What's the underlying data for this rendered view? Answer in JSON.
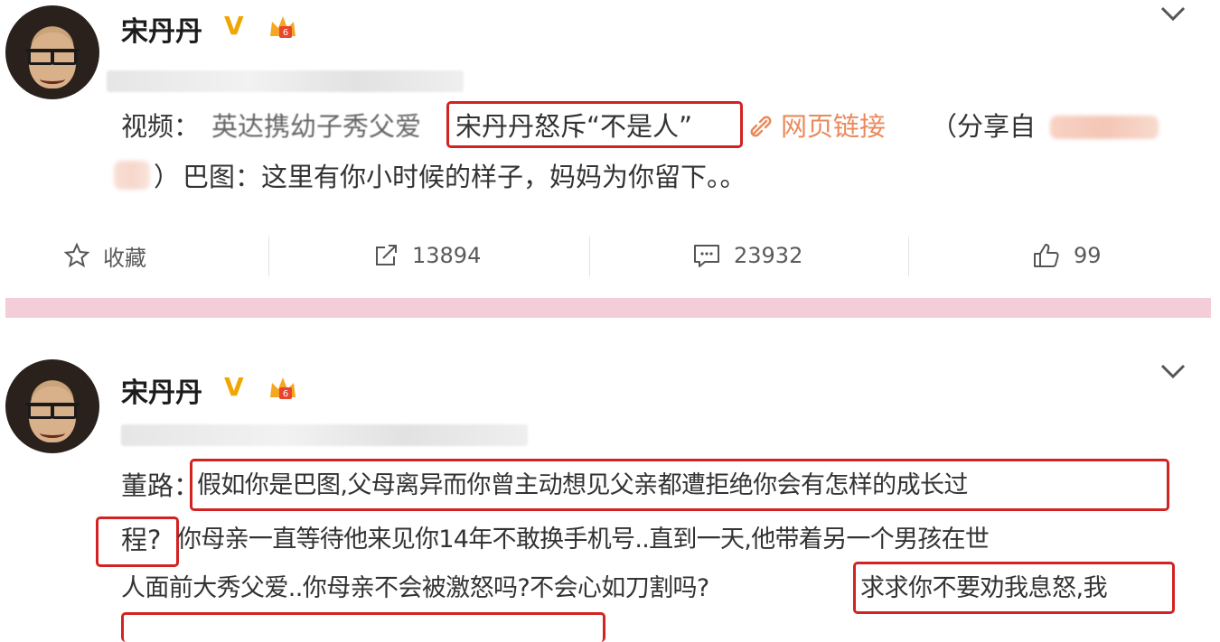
{
  "posts": [
    {
      "username": "宋丹丹",
      "verified_mark": "V",
      "body_line1": {
        "prefix": "视频：",
        "title_blurred": "英达携幼子秀父爱",
        "highlight": "宋丹丹怒斥“不是人”",
        "link_icon": "link-icon",
        "link_label": "网页链接",
        "share_prefix": "（分享自"
      },
      "body_line2": {
        "close": "）",
        "text": "巴图：这里有你小时候的样子，妈妈为你留下。。"
      },
      "actions": {
        "favorite_label": "收藏",
        "repost_count": "13894",
        "comment_count": "23932",
        "like_count": "99"
      }
    },
    {
      "username": "宋丹丹",
      "verified_mark": "V",
      "body": {
        "line1_prefix": "董路：",
        "line1_highlight": "假如你是巴图,父母离异而你曾主动想见父亲都遭拒绝你会有怎样的成长过",
        "line2_highlight": "程?",
        "line2_rest": "你母亲一直等待他来见你14年不敢换手机号..直到一天,他带着另一个男孩在世",
        "line3_text": "人面前大秀父爱..你母亲不会被激怒吗?不会心如刀割吗?",
        "line3_highlight": "求求你不要劝我息怒,我"
      }
    }
  ],
  "colors": {
    "highlight_border": "#d32222",
    "link": "#ea8a5c",
    "divider": "#f3ced8",
    "verified": "#f0a500"
  },
  "icons": [
    "star-icon",
    "repost-icon",
    "comment-icon",
    "like-icon",
    "chevron-down-icon",
    "crown-badge-icon",
    "link-icon"
  ]
}
